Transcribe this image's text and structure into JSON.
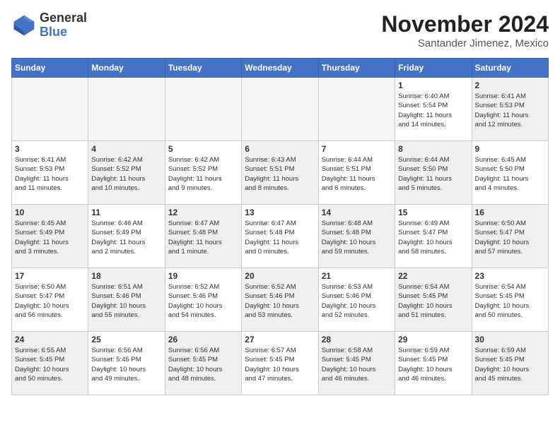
{
  "logo": {
    "line1": "General",
    "line2": "Blue"
  },
  "title": "November 2024",
  "location": "Santander Jimenez, Mexico",
  "headers": [
    "Sunday",
    "Monday",
    "Tuesday",
    "Wednesday",
    "Thursday",
    "Friday",
    "Saturday"
  ],
  "weeks": [
    [
      {
        "day": "",
        "info": "",
        "empty": true
      },
      {
        "day": "",
        "info": "",
        "empty": true
      },
      {
        "day": "",
        "info": "",
        "empty": true
      },
      {
        "day": "",
        "info": "",
        "empty": true
      },
      {
        "day": "",
        "info": "",
        "empty": true
      },
      {
        "day": "1",
        "info": "Sunrise: 6:40 AM\nSunset: 5:54 PM\nDaylight: 11 hours\nand 14 minutes.",
        "empty": false
      },
      {
        "day": "2",
        "info": "Sunrise: 6:41 AM\nSunset: 5:53 PM\nDaylight: 11 hours\nand 12 minutes.",
        "empty": false,
        "shaded": true
      }
    ],
    [
      {
        "day": "3",
        "info": "Sunrise: 6:41 AM\nSunset: 5:53 PM\nDaylight: 11 hours\nand 11 minutes.",
        "empty": false
      },
      {
        "day": "4",
        "info": "Sunrise: 6:42 AM\nSunset: 5:52 PM\nDaylight: 11 hours\nand 10 minutes.",
        "empty": false,
        "shaded": true
      },
      {
        "day": "5",
        "info": "Sunrise: 6:42 AM\nSunset: 5:52 PM\nDaylight: 11 hours\nand 9 minutes.",
        "empty": false
      },
      {
        "day": "6",
        "info": "Sunrise: 6:43 AM\nSunset: 5:51 PM\nDaylight: 11 hours\nand 8 minutes.",
        "empty": false,
        "shaded": true
      },
      {
        "day": "7",
        "info": "Sunrise: 6:44 AM\nSunset: 5:51 PM\nDaylight: 11 hours\nand 6 minutes.",
        "empty": false
      },
      {
        "day": "8",
        "info": "Sunrise: 6:44 AM\nSunset: 5:50 PM\nDaylight: 11 hours\nand 5 minutes.",
        "empty": false,
        "shaded": true
      },
      {
        "day": "9",
        "info": "Sunrise: 6:45 AM\nSunset: 5:50 PM\nDaylight: 11 hours\nand 4 minutes.",
        "empty": false
      }
    ],
    [
      {
        "day": "10",
        "info": "Sunrise: 6:45 AM\nSunset: 5:49 PM\nDaylight: 11 hours\nand 3 minutes.",
        "empty": false,
        "shaded": true
      },
      {
        "day": "11",
        "info": "Sunrise: 6:46 AM\nSunset: 5:49 PM\nDaylight: 11 hours\nand 2 minutes.",
        "empty": false
      },
      {
        "day": "12",
        "info": "Sunrise: 6:47 AM\nSunset: 5:48 PM\nDaylight: 11 hours\nand 1 minute.",
        "empty": false,
        "shaded": true
      },
      {
        "day": "13",
        "info": "Sunrise: 6:47 AM\nSunset: 5:48 PM\nDaylight: 11 hours\nand 0 minutes.",
        "empty": false
      },
      {
        "day": "14",
        "info": "Sunrise: 6:48 AM\nSunset: 5:48 PM\nDaylight: 10 hours\nand 59 minutes.",
        "empty": false,
        "shaded": true
      },
      {
        "day": "15",
        "info": "Sunrise: 6:49 AM\nSunset: 5:47 PM\nDaylight: 10 hours\nand 58 minutes.",
        "empty": false
      },
      {
        "day": "16",
        "info": "Sunrise: 6:50 AM\nSunset: 5:47 PM\nDaylight: 10 hours\nand 57 minutes.",
        "empty": false,
        "shaded": true
      }
    ],
    [
      {
        "day": "17",
        "info": "Sunrise: 6:50 AM\nSunset: 5:47 PM\nDaylight: 10 hours\nand 56 minutes.",
        "empty": false
      },
      {
        "day": "18",
        "info": "Sunrise: 6:51 AM\nSunset: 5:46 PM\nDaylight: 10 hours\nand 55 minutes.",
        "empty": false,
        "shaded": true
      },
      {
        "day": "19",
        "info": "Sunrise: 6:52 AM\nSunset: 5:46 PM\nDaylight: 10 hours\nand 54 minutes.",
        "empty": false
      },
      {
        "day": "20",
        "info": "Sunrise: 6:52 AM\nSunset: 5:46 PM\nDaylight: 10 hours\nand 53 minutes.",
        "empty": false,
        "shaded": true
      },
      {
        "day": "21",
        "info": "Sunrise: 6:53 AM\nSunset: 5:46 PM\nDaylight: 10 hours\nand 52 minutes.",
        "empty": false
      },
      {
        "day": "22",
        "info": "Sunrise: 6:54 AM\nSunset: 5:45 PM\nDaylight: 10 hours\nand 51 minutes.",
        "empty": false,
        "shaded": true
      },
      {
        "day": "23",
        "info": "Sunrise: 6:54 AM\nSunset: 5:45 PM\nDaylight: 10 hours\nand 50 minutes.",
        "empty": false
      }
    ],
    [
      {
        "day": "24",
        "info": "Sunrise: 6:55 AM\nSunset: 5:45 PM\nDaylight: 10 hours\nand 50 minutes.",
        "empty": false,
        "shaded": true
      },
      {
        "day": "25",
        "info": "Sunrise: 6:56 AM\nSunset: 5:45 PM\nDaylight: 10 hours\nand 49 minutes.",
        "empty": false
      },
      {
        "day": "26",
        "info": "Sunrise: 6:56 AM\nSunset: 5:45 PM\nDaylight: 10 hours\nand 48 minutes.",
        "empty": false,
        "shaded": true
      },
      {
        "day": "27",
        "info": "Sunrise: 6:57 AM\nSunset: 5:45 PM\nDaylight: 10 hours\nand 47 minutes.",
        "empty": false
      },
      {
        "day": "28",
        "info": "Sunrise: 6:58 AM\nSunset: 5:45 PM\nDaylight: 10 hours\nand 46 minutes.",
        "empty": false,
        "shaded": true
      },
      {
        "day": "29",
        "info": "Sunrise: 6:59 AM\nSunset: 5:45 PM\nDaylight: 10 hours\nand 46 minutes.",
        "empty": false
      },
      {
        "day": "30",
        "info": "Sunrise: 6:59 AM\nSunset: 5:45 PM\nDaylight: 10 hours\nand 45 minutes.",
        "empty": false,
        "shaded": true
      }
    ]
  ]
}
